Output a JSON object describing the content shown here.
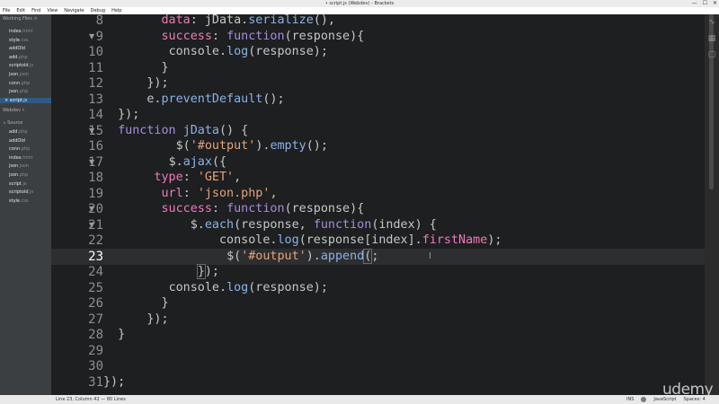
{
  "window": {
    "title": "• script.js (Webdev) - Brackets",
    "controls": [
      "—",
      "☐",
      "✕"
    ]
  },
  "menu": [
    "File",
    "Edit",
    "Find",
    "View",
    "Navigate",
    "Debug",
    "Help"
  ],
  "sidebar": {
    "working_files_header": "Working Files",
    "working_files": [
      {
        "name": "index",
        "ext": ".html"
      },
      {
        "name": "style",
        "ext": ".css"
      },
      {
        "name": "addOld",
        "ext": ""
      },
      {
        "name": "add",
        "ext": ".php"
      },
      {
        "name": "scriptold",
        "ext": ".js"
      },
      {
        "name": "json",
        "ext": ".json"
      },
      {
        "name": "conn",
        "ext": ".php"
      },
      {
        "name": "json",
        "ext": ".php"
      },
      {
        "name": "script",
        "ext": ".js",
        "active": true
      }
    ],
    "project_header": "Webdev",
    "folder": "Source",
    "project_files": [
      {
        "name": "add",
        "ext": ".php"
      },
      {
        "name": "addOld",
        "ext": ""
      },
      {
        "name": "conn",
        "ext": ".php"
      },
      {
        "name": "index",
        "ext": ".html"
      },
      {
        "name": "json",
        "ext": ".json"
      },
      {
        "name": "json",
        "ext": ".php"
      },
      {
        "name": "script",
        "ext": ".js"
      },
      {
        "name": "scriptold",
        "ext": ".js"
      },
      {
        "name": "style",
        "ext": ".css"
      }
    ]
  },
  "editor": {
    "active_line": 23,
    "lines": [
      {
        "n": "8",
        "fold": false,
        "tokens": [
          [
            "",
            "        "
          ],
          [
            "prop",
            "data"
          ],
          [
            "txt",
            ": jData."
          ],
          [
            "fn",
            "serialize"
          ],
          [
            "txt",
            "(),"
          ]
        ]
      },
      {
        "n": "9",
        "fold": true,
        "tokens": [
          [
            "",
            "        "
          ],
          [
            "prop",
            "success"
          ],
          [
            "txt",
            ": "
          ],
          [
            "kw",
            "function"
          ],
          [
            "txt",
            "(response){"
          ]
        ]
      },
      {
        "n": "10",
        "fold": false,
        "tokens": [
          [
            "",
            "         "
          ],
          [
            "txt",
            "console."
          ],
          [
            "fn",
            "log"
          ],
          [
            "txt",
            "(response);"
          ]
        ]
      },
      {
        "n": "11",
        "fold": false,
        "tokens": [
          [
            "",
            "        "
          ],
          [
            "txt",
            "}"
          ]
        ]
      },
      {
        "n": "12",
        "fold": false,
        "tokens": [
          [
            "",
            "      "
          ],
          [
            "txt",
            "});"
          ]
        ]
      },
      {
        "n": "13",
        "fold": false,
        "tokens": [
          [
            "",
            "      "
          ],
          [
            "txt",
            "e."
          ],
          [
            "fn",
            "preventDefault"
          ],
          [
            "txt",
            "();"
          ]
        ]
      },
      {
        "n": "14",
        "fold": false,
        "tokens": [
          [
            "",
            "  "
          ],
          [
            "txt",
            "});"
          ]
        ]
      },
      {
        "n": "15",
        "fold": true,
        "tokens": [
          [
            "",
            "  "
          ],
          [
            "kw",
            "function"
          ],
          [
            "txt",
            " "
          ],
          [
            "fn",
            "jData"
          ],
          [
            "txt",
            "() {"
          ]
        ]
      },
      {
        "n": "16",
        "fold": false,
        "tokens": [
          [
            "",
            "          "
          ],
          [
            "txt",
            "$("
          ],
          [
            "str",
            "'#output'"
          ],
          [
            "txt",
            ")."
          ],
          [
            "fn",
            "empty"
          ],
          [
            "txt",
            "();"
          ]
        ]
      },
      {
        "n": "17",
        "fold": true,
        "tokens": [
          [
            "",
            "         "
          ],
          [
            "txt",
            "$."
          ],
          [
            "fn",
            "ajax"
          ],
          [
            "txt",
            "({"
          ]
        ]
      },
      {
        "n": "18",
        "fold": false,
        "tokens": [
          [
            "",
            "       "
          ],
          [
            "prop",
            "type"
          ],
          [
            "txt",
            ": "
          ],
          [
            "str",
            "'GET'"
          ],
          [
            "txt",
            ","
          ]
        ]
      },
      {
        "n": "19",
        "fold": false,
        "tokens": [
          [
            "",
            "        "
          ],
          [
            "prop",
            "url"
          ],
          [
            "txt",
            ": "
          ],
          [
            "str",
            "'json.php'"
          ],
          [
            "txt",
            ","
          ]
        ]
      },
      {
        "n": "20",
        "fold": true,
        "tokens": [
          [
            "",
            "        "
          ],
          [
            "prop",
            "success"
          ],
          [
            "txt",
            ": "
          ],
          [
            "kw",
            "function"
          ],
          [
            "txt",
            "(response){"
          ]
        ]
      },
      {
        "n": "21",
        "fold": true,
        "tokens": [
          [
            "",
            "            "
          ],
          [
            "txt",
            "$."
          ],
          [
            "fn",
            "each"
          ],
          [
            "txt",
            "(response, "
          ],
          [
            "kw",
            "function"
          ],
          [
            "txt",
            "(index) {"
          ]
        ]
      },
      {
        "n": "22",
        "fold": false,
        "tokens": [
          [
            "",
            "                "
          ],
          [
            "txt",
            "console."
          ],
          [
            "fn",
            "log"
          ],
          [
            "txt",
            "(response[index]."
          ],
          [
            "prop",
            "firstName"
          ],
          [
            "txt",
            ");"
          ]
        ]
      },
      {
        "n": "23",
        "fold": false,
        "tokens": [
          [
            "",
            "                 "
          ],
          [
            "txt",
            "$("
          ],
          [
            "str",
            "'#output'"
          ],
          [
            "txt",
            ")."
          ],
          [
            "fn",
            "append"
          ],
          [
            "hl",
            "("
          ],
          [
            "txt",
            ";"
          ]
        ]
      },
      {
        "n": "24",
        "fold": false,
        "tokens": [
          [
            "",
            "             "
          ],
          [
            "hl",
            "}"
          ],
          [
            "txt",
            ");"
          ]
        ]
      },
      {
        "n": "25",
        "fold": false,
        "tokens": [
          [
            "",
            "         "
          ],
          [
            "txt",
            "console."
          ],
          [
            "fn",
            "log"
          ],
          [
            "txt",
            "(response);"
          ]
        ]
      },
      {
        "n": "26",
        "fold": false,
        "tokens": [
          [
            "",
            "        "
          ],
          [
            "txt",
            "}"
          ]
        ]
      },
      {
        "n": "27",
        "fold": false,
        "tokens": [
          [
            "",
            "      "
          ],
          [
            "txt",
            "});"
          ]
        ]
      },
      {
        "n": "28",
        "fold": false,
        "tokens": [
          [
            "",
            "  "
          ],
          [
            "txt",
            "}"
          ]
        ]
      },
      {
        "n": "29",
        "fold": false,
        "tokens": []
      },
      {
        "n": "30",
        "fold": false,
        "tokens": []
      },
      {
        "n": "31",
        "fold": false,
        "tokens": [
          [
            "txt",
            "});"
          ]
        ]
      }
    ]
  },
  "statusbar": {
    "position": "Line 23, Column 42 — 80 Lines",
    "mode": "INS",
    "language": "JavaScript",
    "spaces": "Spaces: 4"
  },
  "watermark": "udemy",
  "colors": {
    "editor_bg": "#1d1f21",
    "sidebar_bg": "#3c3f41",
    "prop": "#ee7bb8",
    "function": "#8cb2e6",
    "string": "#e6a277",
    "keyword": "#a98cda"
  }
}
